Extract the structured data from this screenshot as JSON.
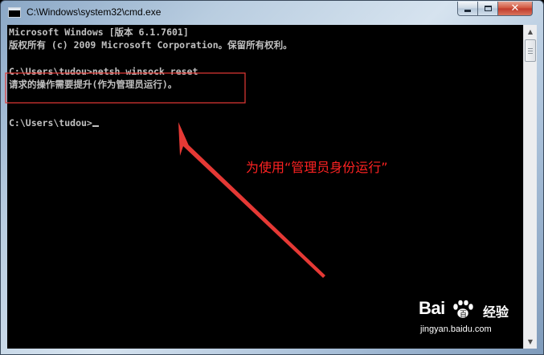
{
  "window": {
    "title": "C:\\Windows\\system32\\cmd.exe",
    "icon": "cmd-icon",
    "controls": {
      "minimize": "minimize-icon",
      "maximize": "maximize-icon",
      "close": "✕"
    }
  },
  "console": {
    "lines": [
      "Microsoft Windows [版本 6.1.7601]",
      "版权所有 (c) 2009 Microsoft Corporation。保留所有权利。",
      "",
      "C:\\Users\\tudou>netsh winsock reset",
      "请求的操作需要提升(作为管理员运行)。",
      "",
      "C:\\Users\\tudou>"
    ]
  },
  "annotation": {
    "text": "为使用“管理员身份运行”",
    "color": "#ff2222"
  },
  "watermark": {
    "brand_left": "Bai",
    "brand_right": "百",
    "product": "经验",
    "url": "jingyan.baidu.com"
  },
  "scrollbar": {
    "up": "▲",
    "down": "▼"
  }
}
